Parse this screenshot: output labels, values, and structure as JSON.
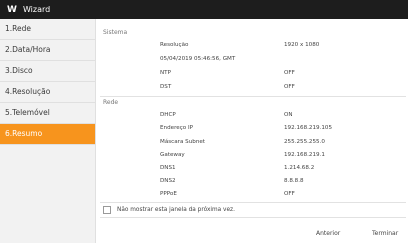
{
  "window": {
    "logo": "W",
    "title": "Wizard"
  },
  "sidebar": {
    "items": [
      {
        "label": "1.Rede"
      },
      {
        "label": "2.Data/Hora"
      },
      {
        "label": "3.Disco"
      },
      {
        "label": "4.Resolução"
      },
      {
        "label": "5.Telemóvel"
      },
      {
        "label": "6.Resumo"
      }
    ],
    "active_index": 5
  },
  "summary": {
    "sistema": {
      "heading": "Sistema",
      "rows": [
        {
          "label": "Resolução",
          "value": "1920 x 1080"
        },
        {
          "label": "05/04/2019 05:46:56, GMT",
          "value": ""
        },
        {
          "label": "NTP",
          "value": "OFF"
        },
        {
          "label": "DST",
          "value": "OFF"
        }
      ]
    },
    "rede": {
      "heading": "Rede",
      "rows": [
        {
          "label": "DHCP",
          "value": "ON"
        },
        {
          "label": "Endereço IP",
          "value": "192.168.219.105"
        },
        {
          "label": "Máscara Subnet",
          "value": "255.255.255.0"
        },
        {
          "label": "Gateway",
          "value": "192.168.219.1"
        },
        {
          "label": "DNS1",
          "value": "1.214.68.2"
        },
        {
          "label": "DNS2",
          "value": "8.8.8.8"
        },
        {
          "label": "PPPoE",
          "value": "OFF"
        }
      ]
    }
  },
  "dont_show": {
    "label": "Não mostrar esta janela da próxima vez.",
    "checked": false
  },
  "footer": {
    "prev_label": "Anterior",
    "finish_label": "Terminar"
  },
  "colors": {
    "accent": "#f7941d",
    "titlebar": "#1d1d1d"
  }
}
